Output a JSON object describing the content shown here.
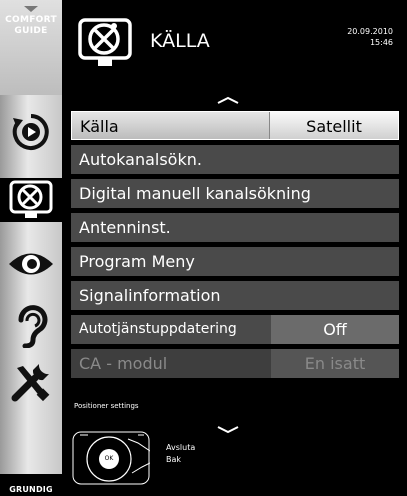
{
  "sidebar": {
    "comfort_guide": "COMFORT\nGUIDE",
    "brand": "GRUNDIG",
    "items": [
      {
        "icon": "play-source-icon"
      },
      {
        "icon": "satellite-dish-icon",
        "active": true
      },
      {
        "icon": "eye-icon"
      },
      {
        "icon": "ear-icon"
      },
      {
        "icon": "tools-icon"
      }
    ]
  },
  "header": {
    "title": "KÄLLA",
    "date": "20.09.2010",
    "time": "15:46"
  },
  "menu": {
    "rows": [
      {
        "label": "Källa",
        "value": "Satellit"
      },
      {
        "label": "Autokanalsökn."
      },
      {
        "label": "Digital manuell kanalsökning"
      },
      {
        "label": "Antenninst."
      },
      {
        "label": "Program Meny"
      },
      {
        "label": "Signalinformation"
      },
      {
        "label": "Autotjänstuppdatering",
        "value": "Off"
      },
      {
        "label": "CA - modul",
        "value": "En isatt"
      }
    ]
  },
  "footer": {
    "hint": "Positioner settings",
    "ok": "OK",
    "exit": "Avsluta",
    "back": "Bak"
  }
}
